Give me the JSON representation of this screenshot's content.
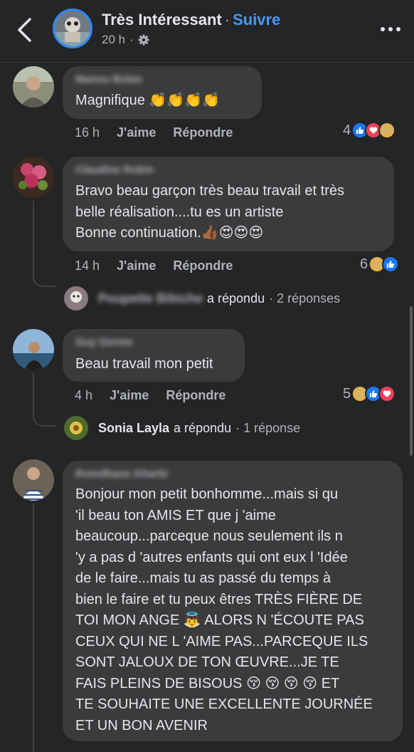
{
  "header": {
    "title": "Très Intéressant",
    "separator": "·",
    "follow": "Suivre",
    "time": "20 h"
  },
  "comments": [
    {
      "author": "Manou Bolan",
      "lines": [
        "Magnifique 👏👏👏👏"
      ],
      "time": "16 h",
      "like": "J'aime",
      "reply": "Répondre",
      "reaction_count": "4"
    },
    {
      "author": "Claudine Robin",
      "lines": [
        "Bravo beau garçon très beau travail et très",
        "belle réalisation....tu es un artiste",
        "Bonne continuation.👍🏾😍😍😍"
      ],
      "time": "14 h",
      "like": "J'aime",
      "reply": "Répondre",
      "reaction_count": "6",
      "replies": {
        "name": "Poupette Bibiche",
        "verb": "a répondu",
        "count": "· 2 réponses"
      }
    },
    {
      "author": "Guy Germe",
      "lines": [
        "Beau travail mon petit"
      ],
      "time": "4 h",
      "like": "J'aime",
      "reply": "Répondre",
      "reaction_count": "5",
      "replies": {
        "name": "Sonia Layla",
        "verb": "a répondu",
        "count": "· 1 réponse"
      }
    },
    {
      "author": "Romdhane Gharbi",
      "lines": [
        "Bonjour mon petit bonhomme...mais si qu",
        "'il beau ton AMIS ET que j 'aime",
        "beaucoup...parceque nous seulement ils n",
        "'y a pas d 'autres enfants qui ont eux l 'Idée",
        "de le faire...mais tu as passé du temps à",
        "bien le faire et tu peux êtres TRÈS FIÈRE DE",
        "TOI MON ANGE 👼 ALORS N 'ÉCOUTE PAS",
        "CEUX QUI NE L 'AIME PAS...PARCEQUE ILS",
        "SONT JALOUX DE TON ŒUVRE...JE TE",
        "FAIS PLEINS DE BISOUS 😚 😚 😚 😚 ET",
        "TE SOUHAITE UNE EXCELLENTE JOURNÉE",
        "ET UN BON AVENIR"
      ]
    }
  ],
  "colors": {
    "background": "#242526",
    "bubble": "#3a3b3c",
    "link": "#4599ff",
    "like": "#1877f2",
    "love": "#f33e58"
  }
}
